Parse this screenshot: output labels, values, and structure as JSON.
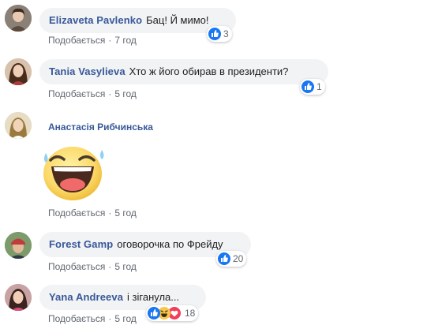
{
  "comments": [
    {
      "author": "Elizaveta Pavlenko",
      "text": "Бац! Й мимо!",
      "like_label": "Подобається",
      "time": "7 год",
      "reaction_count": "3"
    },
    {
      "author": "Tania Vasylieva",
      "text": "Хто ж його обирав в президенти?",
      "like_label": "Подобається",
      "time": "5 год",
      "reaction_count": "1"
    },
    {
      "author": "Анастасія Рибчинська",
      "text": "",
      "like_label": "Подобається",
      "time": "5 год"
    },
    {
      "author": "Forest Gamp",
      "text": "оговорочка по Фрейду",
      "like_label": "Подобається",
      "time": "5 год",
      "reaction_count": "20"
    },
    {
      "author": "Yana Andreeva",
      "text": "і зiганула...",
      "like_label": "Подобається",
      "time": "5 год",
      "reaction_count": "18"
    }
  ],
  "icons": {
    "like": "like-reaction-icon",
    "haha": "haha-reaction-icon",
    "love": "love-reaction-icon",
    "sticker": "laughing-face-sticker"
  },
  "colors": {
    "author": "#385898",
    "like_blue": "#1877f2",
    "love_red": "#f33e58",
    "bubble_bg": "#f2f3f5"
  }
}
